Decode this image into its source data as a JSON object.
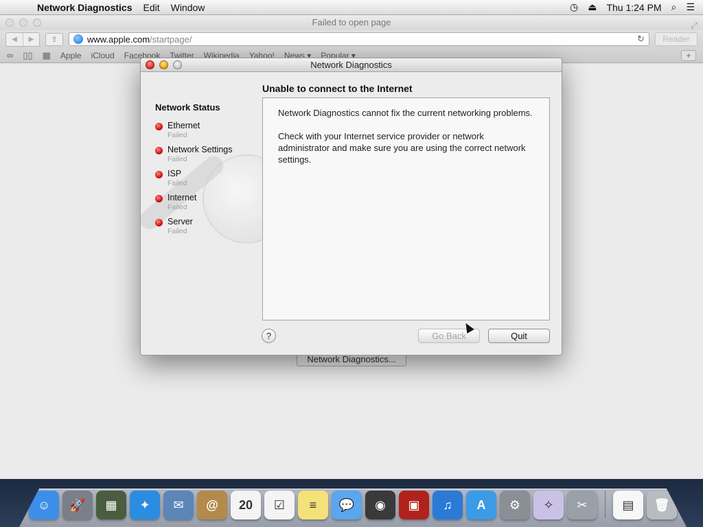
{
  "menubar": {
    "app_name": "Network Diagnostics",
    "items": [
      "Edit",
      "Window"
    ],
    "clock": "Thu 1:24 PM"
  },
  "safari": {
    "title": "Failed to open page",
    "url_host": "www.apple.com",
    "url_path": "/startpage/",
    "reader_label": "Reader",
    "bookmarks": [
      "Apple",
      "iCloud",
      "Facebook",
      "Twitter",
      "Wikipedia",
      "Yahoo!",
      "News ▾",
      "Popular ▾"
    ],
    "behind_button": "Network Diagnostics..."
  },
  "dialog": {
    "title": "Network Diagnostics",
    "status_title": "Network Status",
    "status_items": [
      {
        "name": "Ethernet",
        "state": "Failed"
      },
      {
        "name": "Network Settings",
        "state": "Failed"
      },
      {
        "name": "ISP",
        "state": "Failed"
      },
      {
        "name": "Internet",
        "state": "Failed"
      },
      {
        "name": "Server",
        "state": "Failed"
      }
    ],
    "heading": "Unable to connect to the Internet",
    "message_1": "Network Diagnostics cannot fix the current networking problems.",
    "message_2": "Check with your Internet service provider or network administrator and make sure you are using the correct network settings.",
    "help_label": "?",
    "go_back_label": "Go Back",
    "quit_label": "Quit"
  },
  "dock": {
    "icons": [
      {
        "name": "finder-icon",
        "color": "#3d8ee8",
        "glyph": "☺"
      },
      {
        "name": "launchpad-icon",
        "color": "#7a7f88",
        "glyph": "🚀"
      },
      {
        "name": "mission-control-icon",
        "color": "#4a5d3f",
        "glyph": "▦"
      },
      {
        "name": "safari-icon",
        "color": "#2b8de0",
        "glyph": "✦"
      },
      {
        "name": "mail-icon",
        "color": "#5b86b8",
        "glyph": "✉"
      },
      {
        "name": "contacts-icon",
        "color": "#b48a4c",
        "glyph": "@"
      },
      {
        "name": "calendar-icon",
        "color": "#f4f4f4",
        "glyph": "20"
      },
      {
        "name": "reminders-icon",
        "color": "#f4f4f4",
        "glyph": "☑"
      },
      {
        "name": "notes-icon",
        "color": "#f5e17a",
        "glyph": "≡"
      },
      {
        "name": "messages-icon",
        "color": "#5aa6ef",
        "glyph": "💬"
      },
      {
        "name": "facetime-icon",
        "color": "#3a3a3a",
        "glyph": "◉"
      },
      {
        "name": "photo-booth-icon",
        "color": "#b0231c",
        "glyph": "▣"
      },
      {
        "name": "itunes-icon",
        "color": "#2a7ad6",
        "glyph": "♫"
      },
      {
        "name": "app-store-icon",
        "color": "#3c9be6",
        "glyph": "A"
      },
      {
        "name": "system-preferences-icon",
        "color": "#8a8f96",
        "glyph": "⚙"
      },
      {
        "name": "network-setup-assistant-icon",
        "color": "#c9c2e6",
        "glyph": "✧"
      },
      {
        "name": "utilities-icon",
        "color": "#9aa0a8",
        "glyph": "✂"
      },
      {
        "name": "document-icon",
        "color": "#f7f7f7",
        "glyph": "▤"
      },
      {
        "name": "trash-icon",
        "color": "#b8bcc2",
        "glyph": "🗑"
      }
    ]
  }
}
